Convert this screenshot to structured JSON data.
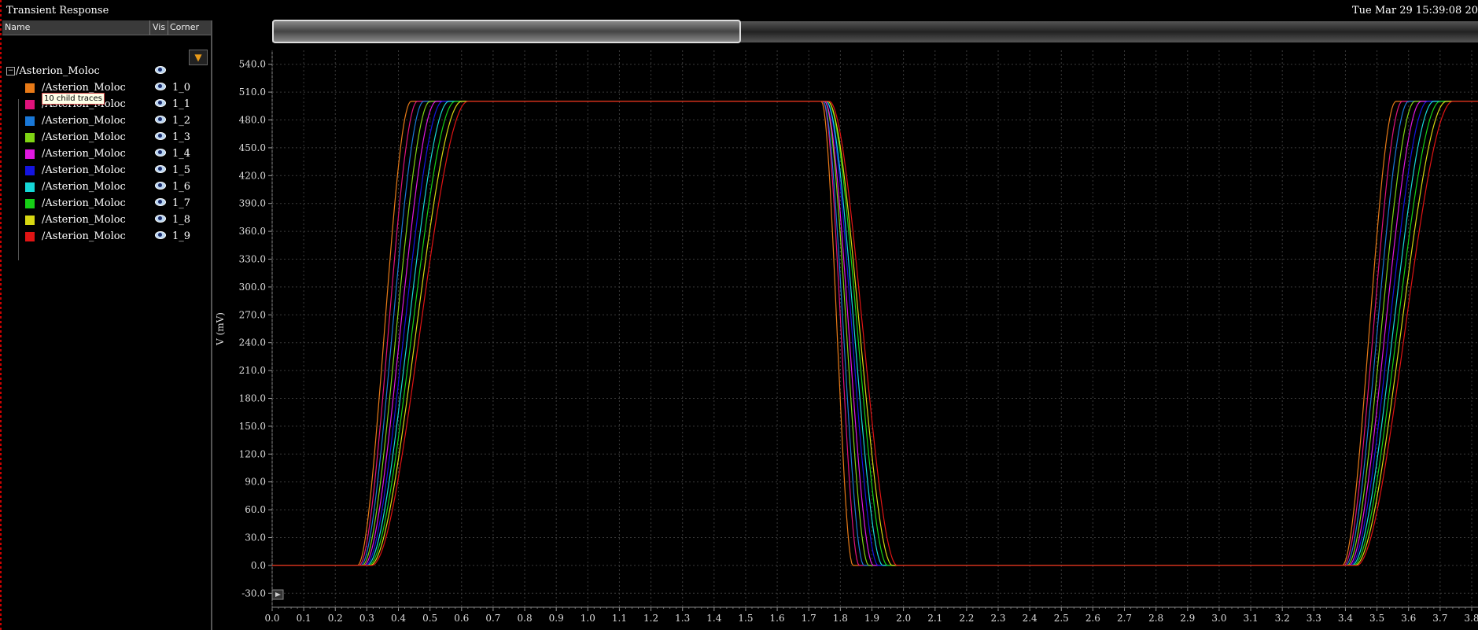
{
  "window": {
    "title": "Transient Response",
    "datetime": "Tue Mar 29 15:39:08 20"
  },
  "panel": {
    "columns": [
      "Name",
      "Vis",
      "Corner"
    ],
    "root_label": "/Asterion_Moloc",
    "tooltip": "10 child traces",
    "traces": [
      {
        "label": "/Asterion_Moloc",
        "corner": "1_0",
        "color": "#e87a17"
      },
      {
        "label": "/Asterion_Moloc",
        "corner": "1_1",
        "color": "#e0127c"
      },
      {
        "label": "/Asterion_Moloc",
        "corner": "1_2",
        "color": "#1978d8"
      },
      {
        "label": "/Asterion_Moloc",
        "corner": "1_3",
        "color": "#7fd414"
      },
      {
        "label": "/Asterion_Moloc",
        "corner": "1_4",
        "color": "#e018e0"
      },
      {
        "label": "/Asterion_Moloc",
        "corner": "1_5",
        "color": "#1414e0"
      },
      {
        "label": "/Asterion_Moloc",
        "corner": "1_6",
        "color": "#16d8d8"
      },
      {
        "label": "/Asterion_Moloc",
        "corner": "1_7",
        "color": "#16d016"
      },
      {
        "label": "/Asterion_Moloc",
        "corner": "1_8",
        "color": "#d8d812"
      },
      {
        "label": "/Asterion_Moloc",
        "corner": "1_9",
        "color": "#e01414"
      }
    ]
  },
  "chart_data": {
    "type": "line",
    "ylabel": "V (mV)",
    "xlabel": "",
    "xlim": [
      0.0,
      3.82
    ],
    "ylim": [
      -45,
      555
    ],
    "y_ticks": [
      "540.0",
      "510.0",
      "480.0",
      "450.0",
      "420.0",
      "390.0",
      "360.0",
      "330.0",
      "300.0",
      "270.0",
      "240.0",
      "210.0",
      "180.0",
      "150.0",
      "120.0",
      "90.0",
      "60.0",
      "30.0",
      "0.0",
      "-30.0"
    ],
    "x_ticks": [
      "0.0",
      "0.1",
      "0.2",
      "0.3",
      "0.4",
      "0.5",
      "0.6",
      "0.7",
      "0.8",
      "0.9",
      "1.0",
      "1.1",
      "1.2",
      "1.3",
      "1.4",
      "1.5",
      "1.6",
      "1.7",
      "1.8",
      "1.9",
      "2.0",
      "2.1",
      "2.2",
      "2.3",
      "2.4",
      "2.5",
      "2.6",
      "2.7",
      "2.8",
      "2.9",
      "3.0",
      "3.1",
      "3.2",
      "3.3",
      "3.4",
      "3.5",
      "3.6",
      "3.7",
      "3.8"
    ],
    "grid": true,
    "series": [
      {
        "name": "1_0",
        "rise1": [
          0.27,
          0.44
        ],
        "fall": [
          1.74,
          1.84
        ],
        "rise2": [
          3.39,
          3.56
        ],
        "high": 500
      },
      {
        "name": "1_1",
        "rise1": [
          0.275,
          0.46
        ],
        "fall": [
          1.745,
          1.86
        ],
        "rise2": [
          3.395,
          3.58
        ],
        "high": 500
      },
      {
        "name": "1_2",
        "rise1": [
          0.28,
          0.48
        ],
        "fall": [
          1.745,
          1.875
        ],
        "rise2": [
          3.4,
          3.6
        ],
        "high": 500
      },
      {
        "name": "1_3",
        "rise1": [
          0.285,
          0.5
        ],
        "fall": [
          1.75,
          1.89
        ],
        "rise2": [
          3.405,
          3.62
        ],
        "high": 500
      },
      {
        "name": "1_4",
        "rise1": [
          0.29,
          0.52
        ],
        "fall": [
          1.75,
          1.905
        ],
        "rise2": [
          3.41,
          3.64
        ],
        "high": 500
      },
      {
        "name": "1_5",
        "rise1": [
          0.295,
          0.54
        ],
        "fall": [
          1.755,
          1.92
        ],
        "rise2": [
          3.415,
          3.66
        ],
        "high": 500
      },
      {
        "name": "1_6",
        "rise1": [
          0.3,
          0.56
        ],
        "fall": [
          1.755,
          1.935
        ],
        "rise2": [
          3.42,
          3.68
        ],
        "high": 500
      },
      {
        "name": "1_7",
        "rise1": [
          0.305,
          0.58
        ],
        "fall": [
          1.76,
          1.95
        ],
        "rise2": [
          3.425,
          3.7
        ],
        "high": 500
      },
      {
        "name": "1_8",
        "rise1": [
          0.31,
          0.6
        ],
        "fall": [
          1.76,
          1.965
        ],
        "rise2": [
          3.43,
          3.72
        ],
        "high": 500
      },
      {
        "name": "1_9",
        "rise1": [
          0.315,
          0.62
        ],
        "fall": [
          1.765,
          1.98
        ],
        "rise2": [
          3.435,
          3.74
        ],
        "high": 500
      }
    ]
  }
}
